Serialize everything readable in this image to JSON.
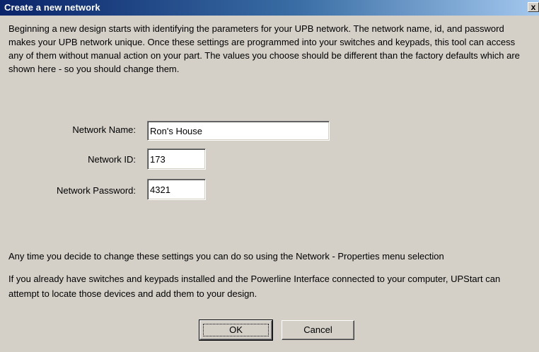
{
  "dialog": {
    "title": "Create a new network",
    "close_symbol": "x"
  },
  "intro_text": "Beginning a new design starts with identifying the parameters for your UPB network.  The network name, id, and password makes your UPB network unique.  Once these settings are programmed into your switches and keypads, this tool can access any of them without manual action on your part.  The values you choose should be different than the factory defaults which are shown here - so you should change them.",
  "fields": {
    "network_name": {
      "label": "Network Name:",
      "value": "Ron's House"
    },
    "network_id": {
      "label": "Network ID:",
      "value": "173"
    },
    "network_password": {
      "label": "Network Password:",
      "value": "4321"
    }
  },
  "note_properties": "Any time you decide to change these settings you can do so using the Network - Properties menu selection",
  "note_locate": "If you already have switches and keypads installed and the Powerline Interface connected to your computer, UPStart can attempt to locate those devices and add them to your design.",
  "buttons": {
    "ok": "OK",
    "cancel": "Cancel"
  }
}
